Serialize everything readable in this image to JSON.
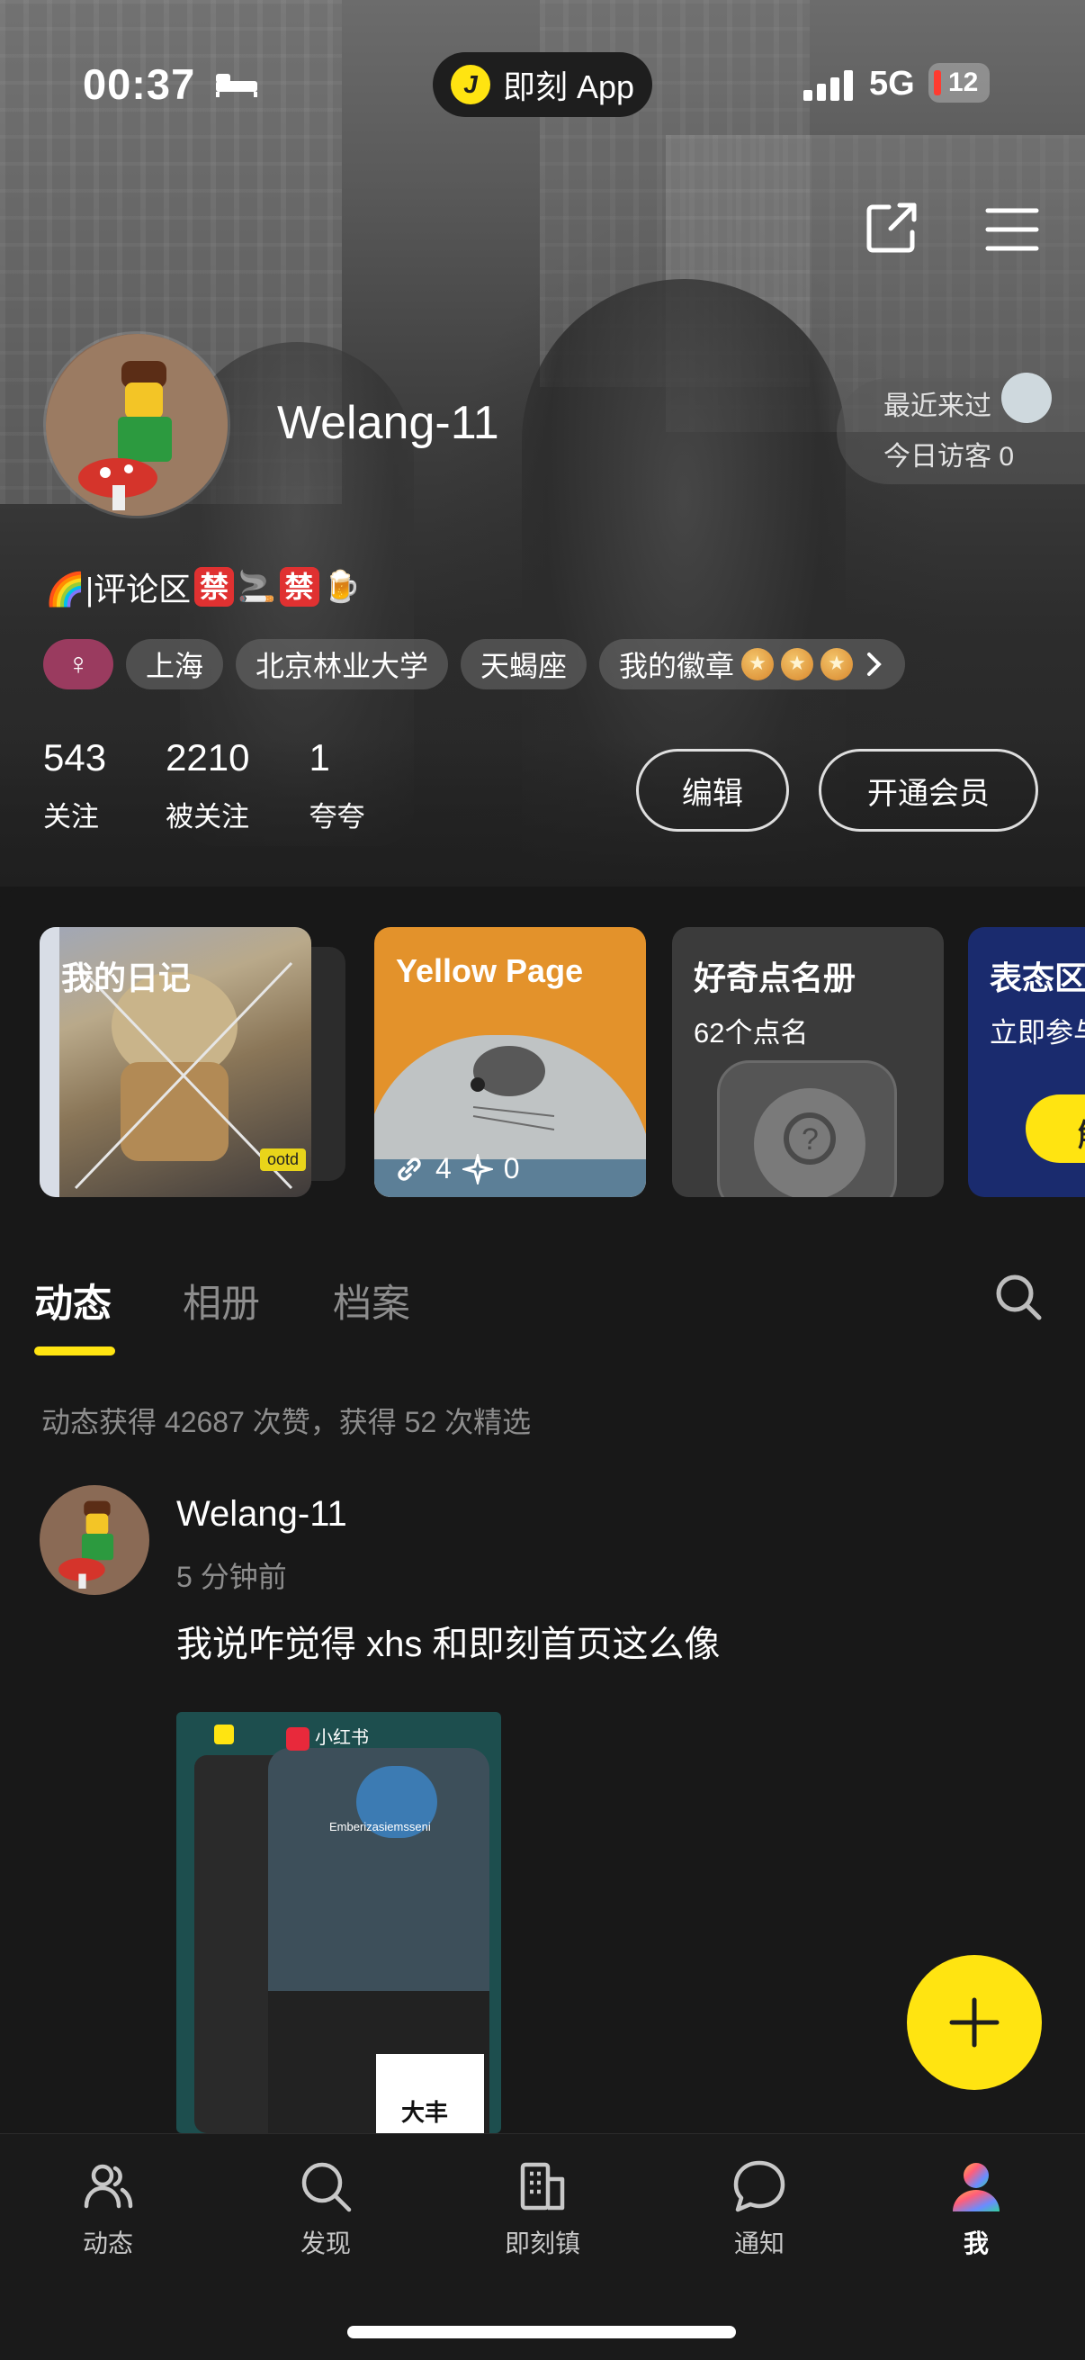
{
  "status_bar": {
    "time": "00:37",
    "pill_app": "即刻 App",
    "network": "5G",
    "battery": "12"
  },
  "profile": {
    "username": "Welang-11",
    "bio_prefix": "🌈|评论区",
    "ban_char": "禁",
    "tags": {
      "gender": "♀",
      "city": "上海",
      "school": "北京林业大学",
      "zodiac": "天蝎座",
      "badges": "我的徽章"
    },
    "visitor": {
      "recent": "最近来过",
      "today": "今日访客 0"
    },
    "stats": [
      {
        "num": "543",
        "label": "关注"
      },
      {
        "num": "2210",
        "label": "被关注"
      },
      {
        "num": "1",
        "label": "夸夸"
      }
    ],
    "buttons": {
      "edit": "编辑",
      "vip": "开通会员"
    }
  },
  "cards": {
    "diary": {
      "title": "我的日记",
      "tag": "ootd"
    },
    "yellow": {
      "title": "Yellow Page",
      "links": "4",
      "stars": "0"
    },
    "curious": {
      "title": "好奇点名册",
      "sub": "62个点名"
    },
    "opinion": {
      "title": "表态区",
      "sub": "立即参与",
      "btn": "解"
    }
  },
  "tabs": {
    "items": [
      "动态",
      "相册",
      "档案"
    ],
    "active_index": 0
  },
  "summary": "动态获得 42687 次赞，获得 52 次精选",
  "post": {
    "user": "Welang-11",
    "time": "5 分钟前",
    "text": "我说咋觉得 xhs 和即刻首页这么像",
    "image_labels": {
      "xhs": "小红书",
      "name": "Emberizasiemsseni",
      "promo": "大丰"
    }
  },
  "nav": [
    {
      "label": "动态",
      "icon": "people-icon"
    },
    {
      "label": "发现",
      "icon": "search-icon"
    },
    {
      "label": "即刻镇",
      "icon": "building-icon"
    },
    {
      "label": "通知",
      "icon": "chat-bubble-icon"
    },
    {
      "label": "我",
      "icon": "profile-icon"
    }
  ],
  "colors": {
    "accent": "#ffe411",
    "background": "#181818",
    "gender_tag": "#9a3b5f",
    "ban": "#e03131"
  }
}
